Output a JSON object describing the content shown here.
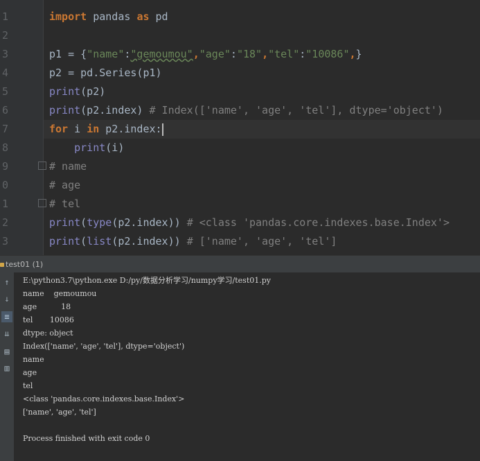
{
  "editor": {
    "line_numbers": [
      "1",
      "2",
      "3",
      "4",
      "5",
      "6",
      "7",
      "8",
      "9",
      "0",
      "1",
      "2",
      "3"
    ],
    "lines": [
      {
        "segments": [
          {
            "t": "import",
            "c": "kw"
          },
          {
            "t": " pandas ",
            "c": ""
          },
          {
            "t": "as",
            "c": "kw"
          },
          {
            "t": " pd",
            "c": ""
          }
        ]
      },
      {
        "segments": []
      },
      {
        "segments": [
          {
            "t": "p1 = {",
            "c": ""
          },
          {
            "t": "\"name\"",
            "c": "str"
          },
          {
            "t": ":",
            "c": ""
          },
          {
            "t": "\"gemoumou\"",
            "c": "str wavy"
          },
          {
            "t": ",",
            "c": "kw"
          },
          {
            "t": "\"age\"",
            "c": "str"
          },
          {
            "t": ":",
            "c": ""
          },
          {
            "t": "\"18\"",
            "c": "str"
          },
          {
            "t": ",",
            "c": "kw"
          },
          {
            "t": "\"tel\"",
            "c": "str"
          },
          {
            "t": ":",
            "c": ""
          },
          {
            "t": "\"10086\"",
            "c": "str"
          },
          {
            "t": ",",
            "c": "kw"
          },
          {
            "t": "}",
            "c": ""
          }
        ]
      },
      {
        "segments": [
          {
            "t": "p2 = pd.Series(p1)",
            "c": ""
          }
        ]
      },
      {
        "segments": [
          {
            "t": "print",
            "c": "fn"
          },
          {
            "t": "(p2)",
            "c": ""
          }
        ]
      },
      {
        "segments": [
          {
            "t": "print",
            "c": "fn"
          },
          {
            "t": "(p2.index) ",
            "c": ""
          },
          {
            "t": "# Index(['name', 'age', 'tel'], dtype='object')",
            "c": "cmt"
          }
        ]
      },
      {
        "segments": [
          {
            "t": "for",
            "c": "kw"
          },
          {
            "t": " i ",
            "c": ""
          },
          {
            "t": "in",
            "c": "kw"
          },
          {
            "t": " p2.index:",
            "c": ""
          }
        ],
        "caret": true
      },
      {
        "segments": [
          {
            "t": "    ",
            "c": ""
          },
          {
            "t": "print",
            "c": "fn"
          },
          {
            "t": "(i)",
            "c": ""
          }
        ]
      },
      {
        "segments": [
          {
            "t": "# name",
            "c": "cmt"
          }
        ]
      },
      {
        "segments": [
          {
            "t": "# age",
            "c": "cmt"
          }
        ]
      },
      {
        "segments": [
          {
            "t": "# tel",
            "c": "cmt"
          }
        ]
      },
      {
        "segments": [
          {
            "t": "print",
            "c": "fn"
          },
          {
            "t": "(",
            "c": ""
          },
          {
            "t": "type",
            "c": "fn"
          },
          {
            "t": "(p2.index)) ",
            "c": ""
          },
          {
            "t": "# <class 'pandas.core.indexes.base.Index'>",
            "c": "cmt"
          }
        ]
      },
      {
        "segments": [
          {
            "t": "print",
            "c": "fn"
          },
          {
            "t": "(",
            "c": ""
          },
          {
            "t": "list",
            "c": "fn"
          },
          {
            "t": "(p2.index)) ",
            "c": ""
          },
          {
            "t": "# ['name', 'age', 'tel']",
            "c": "cmt"
          }
        ]
      }
    ]
  },
  "run_tab": {
    "label": "test01 (1)"
  },
  "console": {
    "lines": [
      "E:\\python3.7\\python.exe D:/py/数据分析学习/numpy学习/test01.py",
      "name    gemoumou",
      "age          18",
      "tel       10086",
      "dtype: object",
      "Index(['name', 'age', 'tel'], dtype='object')",
      "name",
      "age",
      "tel",
      "<class 'pandas.core.indexes.base.Index'>",
      "['name', 'age', 'tel']",
      "",
      "Process finished with exit code 0"
    ]
  },
  "toolbar": {
    "icons": [
      "arrow-up-icon",
      "arrow-down-icon",
      "soft-wrap-icon",
      "scroll-to-end-icon",
      "print-icon",
      "trash-icon"
    ]
  }
}
